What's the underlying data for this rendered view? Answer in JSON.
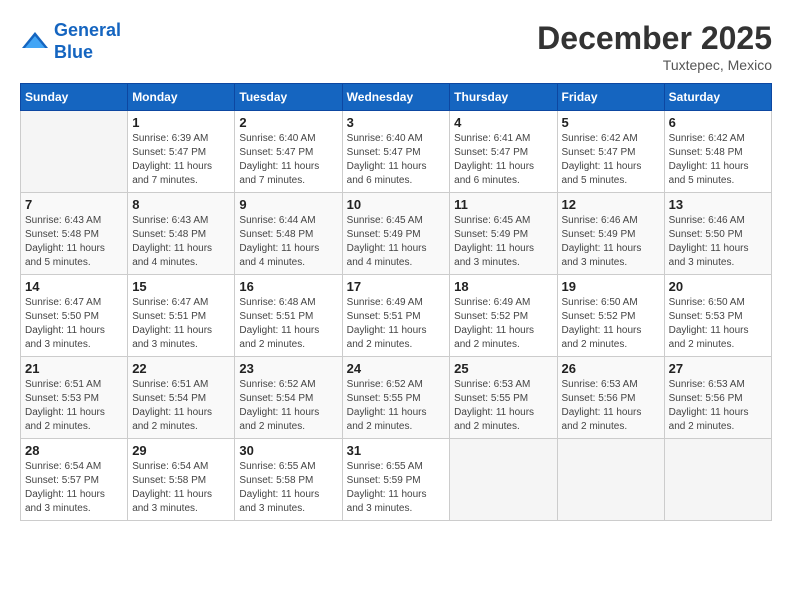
{
  "header": {
    "logo_line1": "General",
    "logo_line2": "Blue",
    "month_title": "December 2025",
    "location": "Tuxtepec, Mexico"
  },
  "days_of_week": [
    "Sunday",
    "Monday",
    "Tuesday",
    "Wednesday",
    "Thursday",
    "Friday",
    "Saturday"
  ],
  "weeks": [
    [
      {
        "day": "",
        "sunrise": "",
        "sunset": "",
        "daylight": ""
      },
      {
        "day": "1",
        "sunrise": "Sunrise: 6:39 AM",
        "sunset": "Sunset: 5:47 PM",
        "daylight": "Daylight: 11 hours and 7 minutes."
      },
      {
        "day": "2",
        "sunrise": "Sunrise: 6:40 AM",
        "sunset": "Sunset: 5:47 PM",
        "daylight": "Daylight: 11 hours and 7 minutes."
      },
      {
        "day": "3",
        "sunrise": "Sunrise: 6:40 AM",
        "sunset": "Sunset: 5:47 PM",
        "daylight": "Daylight: 11 hours and 6 minutes."
      },
      {
        "day": "4",
        "sunrise": "Sunrise: 6:41 AM",
        "sunset": "Sunset: 5:47 PM",
        "daylight": "Daylight: 11 hours and 6 minutes."
      },
      {
        "day": "5",
        "sunrise": "Sunrise: 6:42 AM",
        "sunset": "Sunset: 5:47 PM",
        "daylight": "Daylight: 11 hours and 5 minutes."
      },
      {
        "day": "6",
        "sunrise": "Sunrise: 6:42 AM",
        "sunset": "Sunset: 5:48 PM",
        "daylight": "Daylight: 11 hours and 5 minutes."
      }
    ],
    [
      {
        "day": "7",
        "sunrise": "Sunrise: 6:43 AM",
        "sunset": "Sunset: 5:48 PM",
        "daylight": "Daylight: 11 hours and 5 minutes."
      },
      {
        "day": "8",
        "sunrise": "Sunrise: 6:43 AM",
        "sunset": "Sunset: 5:48 PM",
        "daylight": "Daylight: 11 hours and 4 minutes."
      },
      {
        "day": "9",
        "sunrise": "Sunrise: 6:44 AM",
        "sunset": "Sunset: 5:48 PM",
        "daylight": "Daylight: 11 hours and 4 minutes."
      },
      {
        "day": "10",
        "sunrise": "Sunrise: 6:45 AM",
        "sunset": "Sunset: 5:49 PM",
        "daylight": "Daylight: 11 hours and 4 minutes."
      },
      {
        "day": "11",
        "sunrise": "Sunrise: 6:45 AM",
        "sunset": "Sunset: 5:49 PM",
        "daylight": "Daylight: 11 hours and 3 minutes."
      },
      {
        "day": "12",
        "sunrise": "Sunrise: 6:46 AM",
        "sunset": "Sunset: 5:49 PM",
        "daylight": "Daylight: 11 hours and 3 minutes."
      },
      {
        "day": "13",
        "sunrise": "Sunrise: 6:46 AM",
        "sunset": "Sunset: 5:50 PM",
        "daylight": "Daylight: 11 hours and 3 minutes."
      }
    ],
    [
      {
        "day": "14",
        "sunrise": "Sunrise: 6:47 AM",
        "sunset": "Sunset: 5:50 PM",
        "daylight": "Daylight: 11 hours and 3 minutes."
      },
      {
        "day": "15",
        "sunrise": "Sunrise: 6:47 AM",
        "sunset": "Sunset: 5:51 PM",
        "daylight": "Daylight: 11 hours and 3 minutes."
      },
      {
        "day": "16",
        "sunrise": "Sunrise: 6:48 AM",
        "sunset": "Sunset: 5:51 PM",
        "daylight": "Daylight: 11 hours and 2 minutes."
      },
      {
        "day": "17",
        "sunrise": "Sunrise: 6:49 AM",
        "sunset": "Sunset: 5:51 PM",
        "daylight": "Daylight: 11 hours and 2 minutes."
      },
      {
        "day": "18",
        "sunrise": "Sunrise: 6:49 AM",
        "sunset": "Sunset: 5:52 PM",
        "daylight": "Daylight: 11 hours and 2 minutes."
      },
      {
        "day": "19",
        "sunrise": "Sunrise: 6:50 AM",
        "sunset": "Sunset: 5:52 PM",
        "daylight": "Daylight: 11 hours and 2 minutes."
      },
      {
        "day": "20",
        "sunrise": "Sunrise: 6:50 AM",
        "sunset": "Sunset: 5:53 PM",
        "daylight": "Daylight: 11 hours and 2 minutes."
      }
    ],
    [
      {
        "day": "21",
        "sunrise": "Sunrise: 6:51 AM",
        "sunset": "Sunset: 5:53 PM",
        "daylight": "Daylight: 11 hours and 2 minutes."
      },
      {
        "day": "22",
        "sunrise": "Sunrise: 6:51 AM",
        "sunset": "Sunset: 5:54 PM",
        "daylight": "Daylight: 11 hours and 2 minutes."
      },
      {
        "day": "23",
        "sunrise": "Sunrise: 6:52 AM",
        "sunset": "Sunset: 5:54 PM",
        "daylight": "Daylight: 11 hours and 2 minutes."
      },
      {
        "day": "24",
        "sunrise": "Sunrise: 6:52 AM",
        "sunset": "Sunset: 5:55 PM",
        "daylight": "Daylight: 11 hours and 2 minutes."
      },
      {
        "day": "25",
        "sunrise": "Sunrise: 6:53 AM",
        "sunset": "Sunset: 5:55 PM",
        "daylight": "Daylight: 11 hours and 2 minutes."
      },
      {
        "day": "26",
        "sunrise": "Sunrise: 6:53 AM",
        "sunset": "Sunset: 5:56 PM",
        "daylight": "Daylight: 11 hours and 2 minutes."
      },
      {
        "day": "27",
        "sunrise": "Sunrise: 6:53 AM",
        "sunset": "Sunset: 5:56 PM",
        "daylight": "Daylight: 11 hours and 2 minutes."
      }
    ],
    [
      {
        "day": "28",
        "sunrise": "Sunrise: 6:54 AM",
        "sunset": "Sunset: 5:57 PM",
        "daylight": "Daylight: 11 hours and 3 minutes."
      },
      {
        "day": "29",
        "sunrise": "Sunrise: 6:54 AM",
        "sunset": "Sunset: 5:58 PM",
        "daylight": "Daylight: 11 hours and 3 minutes."
      },
      {
        "day": "30",
        "sunrise": "Sunrise: 6:55 AM",
        "sunset": "Sunset: 5:58 PM",
        "daylight": "Daylight: 11 hours and 3 minutes."
      },
      {
        "day": "31",
        "sunrise": "Sunrise: 6:55 AM",
        "sunset": "Sunset: 5:59 PM",
        "daylight": "Daylight: 11 hours and 3 minutes."
      },
      {
        "day": "",
        "sunrise": "",
        "sunset": "",
        "daylight": ""
      },
      {
        "day": "",
        "sunrise": "",
        "sunset": "",
        "daylight": ""
      },
      {
        "day": "",
        "sunrise": "",
        "sunset": "",
        "daylight": ""
      }
    ]
  ]
}
